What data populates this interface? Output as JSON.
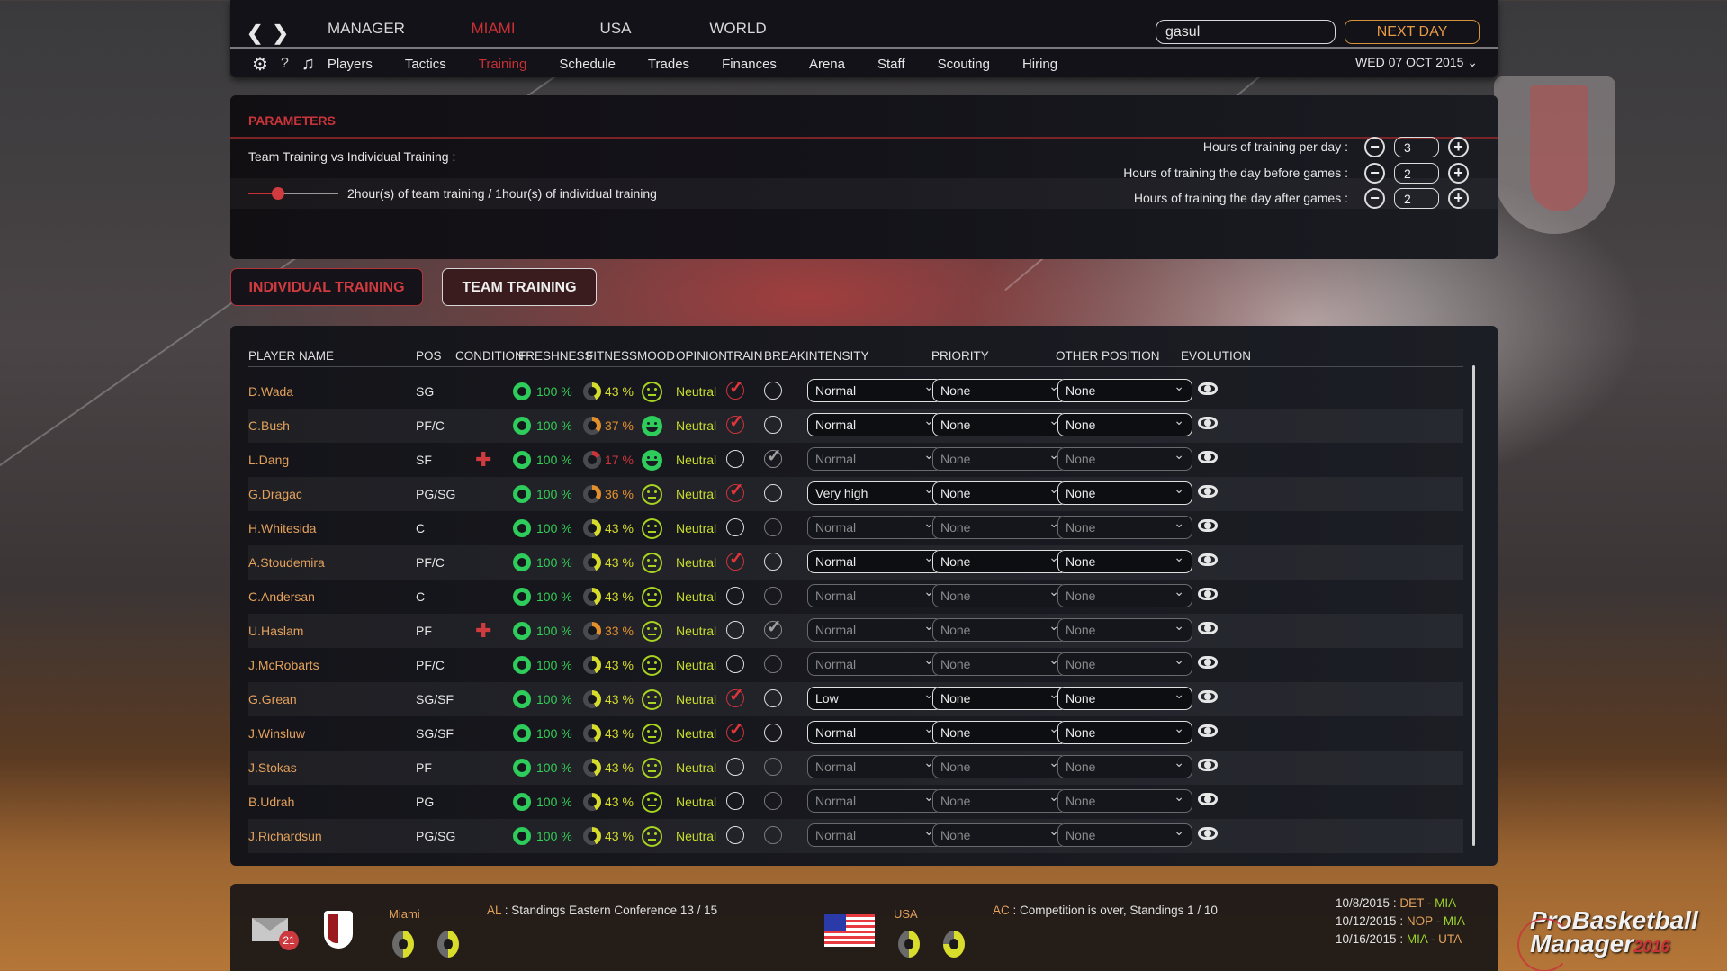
{
  "nav": {
    "main_tabs": [
      "MANAGER",
      "MIAMI",
      "USA",
      "WORLD"
    ],
    "active_main_tab": "MIAMI",
    "search_value": "gasul",
    "next_day_label": "NEXT DAY",
    "sub_items": [
      "Players",
      "Tactics",
      "Training",
      "Schedule",
      "Trades",
      "Finances",
      "Arena",
      "Staff",
      "Scouting",
      "Hiring"
    ],
    "active_sub_item": "Training",
    "help_label": "?",
    "date": "WED 07 OCT 2015",
    "icons": {
      "back": "chevron-left-icon",
      "forward": "chevron-right-icon",
      "settings": "gear-icon",
      "music": "music-note-icon",
      "date_dropdown": "chevron-down-icon"
    }
  },
  "parameters": {
    "title": "PARAMETERS",
    "team_vs_individual_label": "Team Training vs Individual Training :",
    "slider_value_fraction": 0.33,
    "slider_text": "2hour(s) of team training / 1hour(s) of individual training",
    "hours": [
      {
        "label": "Hours of training per day :",
        "value": "3"
      },
      {
        "label": "Hours of training the day before games :",
        "value": "2"
      },
      {
        "label": "Hours of training the day after games :",
        "value": "2"
      }
    ],
    "minus_symbol": "−",
    "plus_symbol": "+"
  },
  "tabs": {
    "individual": "INDIVIDUAL TRAINING",
    "team": "TEAM TRAINING",
    "active": "individual"
  },
  "table": {
    "columns": [
      "PLAYER NAME",
      "POS",
      "CONDITION",
      "FRESHNESS",
      "FITNESS",
      "MOOD",
      "OPINION",
      "TRAIN",
      "BREAK",
      "INTENSITY",
      "PRIORITY",
      "OTHER POSITION",
      "EVOLUTION"
    ],
    "rows": [
      {
        "name": "D.Wada",
        "pos": "SG",
        "injured": false,
        "freshness": "100 %",
        "fitness": "43 %",
        "fitness_level": "yellow",
        "mood": "neutral",
        "opinion": "Neutral",
        "train": true,
        "break": false,
        "intensity": "Normal",
        "priority": "None",
        "other_position": "None"
      },
      {
        "name": "C.Bush",
        "pos": "PF/C",
        "injured": false,
        "freshness": "100 %",
        "fitness": "37 %",
        "fitness_level": "orange",
        "mood": "happy",
        "opinion": "Neutral",
        "train": true,
        "break": false,
        "intensity": "Normal",
        "priority": "None",
        "other_position": "None"
      },
      {
        "name": "L.Dang",
        "pos": "SF",
        "injured": true,
        "freshness": "100 %",
        "fitness": "17 %",
        "fitness_level": "red",
        "mood": "happy",
        "opinion": "Neutral",
        "train": false,
        "break": true,
        "intensity": "Normal",
        "priority": "None",
        "other_position": "None"
      },
      {
        "name": "G.Dragac",
        "pos": "PG/SG",
        "injured": false,
        "freshness": "100 %",
        "fitness": "36 %",
        "fitness_level": "orange",
        "mood": "neutral",
        "opinion": "Neutral",
        "train": true,
        "break": false,
        "intensity": "Very high",
        "priority": "None",
        "other_position": "None"
      },
      {
        "name": "H.Whitesida",
        "pos": "C",
        "injured": false,
        "freshness": "100 %",
        "fitness": "43 %",
        "fitness_level": "yellow",
        "mood": "neutral",
        "opinion": "Neutral",
        "train": false,
        "break": false,
        "intensity": "Normal",
        "priority": "None",
        "other_position": "None"
      },
      {
        "name": "A.Stoudemira",
        "pos": "PF/C",
        "injured": false,
        "freshness": "100 %",
        "fitness": "43 %",
        "fitness_level": "yellow",
        "mood": "neutral",
        "opinion": "Neutral",
        "train": true,
        "break": false,
        "intensity": "Normal",
        "priority": "None",
        "other_position": "None"
      },
      {
        "name": "C.Andersan",
        "pos": "C",
        "injured": false,
        "freshness": "100 %",
        "fitness": "43 %",
        "fitness_level": "yellow",
        "mood": "neutral",
        "opinion": "Neutral",
        "train": false,
        "break": false,
        "intensity": "Normal",
        "priority": "None",
        "other_position": "None"
      },
      {
        "name": "U.Haslam",
        "pos": "PF",
        "injured": true,
        "freshness": "100 %",
        "fitness": "33 %",
        "fitness_level": "orange",
        "mood": "neutral",
        "opinion": "Neutral",
        "train": false,
        "break": true,
        "intensity": "Normal",
        "priority": "None",
        "other_position": "None"
      },
      {
        "name": "J.McRobarts",
        "pos": "PF/C",
        "injured": false,
        "freshness": "100 %",
        "fitness": "43 %",
        "fitness_level": "yellow",
        "mood": "neutral",
        "opinion": "Neutral",
        "train": false,
        "break": false,
        "intensity": "Normal",
        "priority": "None",
        "other_position": "None"
      },
      {
        "name": "G.Grean",
        "pos": "SG/SF",
        "injured": false,
        "freshness": "100 %",
        "fitness": "43 %",
        "fitness_level": "yellow",
        "mood": "neutral",
        "opinion": "Neutral",
        "train": true,
        "break": false,
        "intensity": "Low",
        "priority": "None",
        "other_position": "None"
      },
      {
        "name": "J.Winsluw",
        "pos": "SG/SF",
        "injured": false,
        "freshness": "100 %",
        "fitness": "43 %",
        "fitness_level": "yellow",
        "mood": "neutral",
        "opinion": "Neutral",
        "train": true,
        "break": false,
        "intensity": "Normal",
        "priority": "None",
        "other_position": "None"
      },
      {
        "name": "J.Stokas",
        "pos": "PF",
        "injured": false,
        "freshness": "100 %",
        "fitness": "43 %",
        "fitness_level": "yellow",
        "mood": "neutral",
        "opinion": "Neutral",
        "train": false,
        "break": false,
        "intensity": "Normal",
        "priority": "None",
        "other_position": "None"
      },
      {
        "name": "B.Udrah",
        "pos": "PG",
        "injured": false,
        "freshness": "100 %",
        "fitness": "43 %",
        "fitness_level": "yellow",
        "mood": "neutral",
        "opinion": "Neutral",
        "train": false,
        "break": false,
        "intensity": "Normal",
        "priority": "None",
        "other_position": "None"
      },
      {
        "name": "J.Richardsun",
        "pos": "PG/SG",
        "injured": false,
        "freshness": "100 %",
        "fitness": "43 %",
        "fitness_level": "yellow",
        "mood": "neutral",
        "opinion": "Neutral",
        "train": false,
        "break": false,
        "intensity": "Normal",
        "priority": "None",
        "other_position": "None"
      }
    ]
  },
  "colors": {
    "accent_red": "#c83035",
    "name_orange": "#e3a15c",
    "green": "#2ecc5a",
    "yellow": "#d5dc2b",
    "orange": "#e38f2c",
    "red": "#c9353b"
  },
  "footer": {
    "mail_count": "21",
    "team_label": "Miami",
    "team_comp_prefix": "AL",
    "team_comp_text": " : Standings Eastern Conference 13 / 15",
    "country_label": "USA",
    "country_comp_prefix": "AC",
    "country_comp_text": " : Competition is over, Standings 1 / 10",
    "schedule": [
      {
        "date": "10/8/2015",
        "home": "DET",
        "away": "MIA"
      },
      {
        "date": "10/12/2015",
        "home": "NOP",
        "away": "MIA"
      },
      {
        "date": "10/16/2015",
        "home": "MIA",
        "away": "UTA"
      }
    ]
  },
  "logo": {
    "line1": "ProBasketball",
    "line2": "Manager",
    "year": "2016"
  }
}
